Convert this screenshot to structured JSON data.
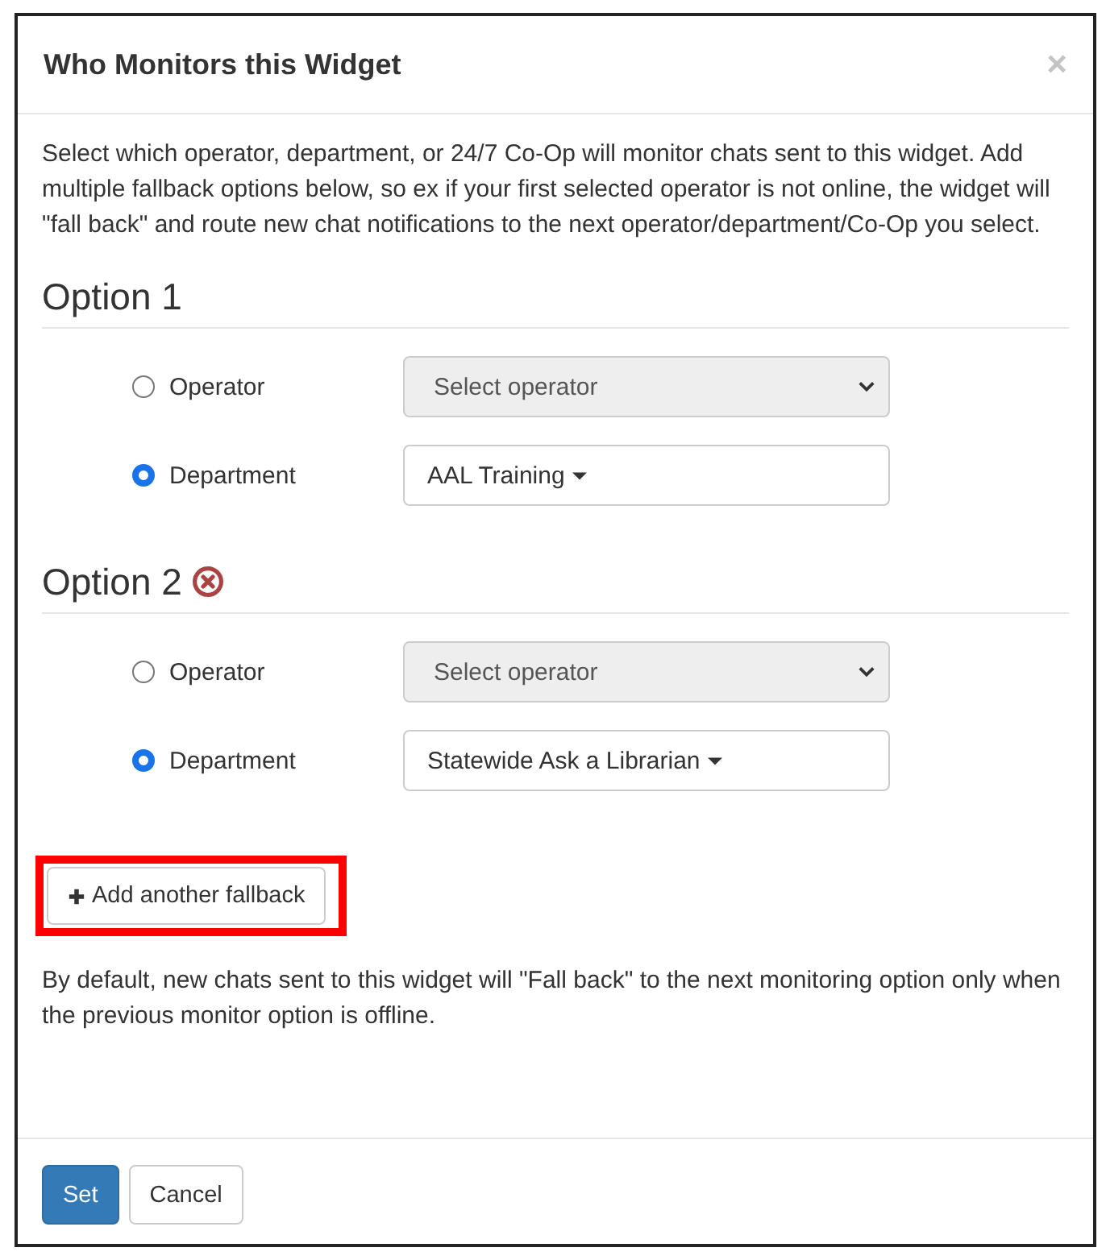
{
  "dialog": {
    "title": "Who Monitors this Widget",
    "close": "×"
  },
  "intro": "Select which operator, department, or 24/7 Co-Op will monitor chats sent to this widget. Add multiple fallback options below, so ex if your first selected operator is not online, the widget will \"fall back\" and route new chat notifications to the next operator/department/Co-Op you select.",
  "options": [
    {
      "heading": "Option 1",
      "removable": false,
      "choices": [
        {
          "kind": "select",
          "label": "Operator",
          "selected": false,
          "placeholder": "Select operator",
          "disabled": true
        },
        {
          "kind": "dropdown",
          "label": "Department",
          "selected": true,
          "value": "AAL Training"
        }
      ]
    },
    {
      "heading": "Option 2",
      "removable": true,
      "choices": [
        {
          "kind": "select",
          "label": "Operator",
          "selected": false,
          "placeholder": "Select operator",
          "disabled": true
        },
        {
          "kind": "dropdown",
          "label": "Department",
          "selected": true,
          "value": "Statewide Ask a Librarian"
        }
      ]
    }
  ],
  "add_button": {
    "label": "Add another fallback",
    "highlighted": true
  },
  "note": "By default, new chats sent to this widget will \"Fall back\" to the next monitoring option only when the previous monitor option is offline.",
  "buttons": [
    {
      "label": "Set",
      "kind": "primary"
    },
    {
      "label": "Cancel",
      "kind": "default"
    }
  ]
}
